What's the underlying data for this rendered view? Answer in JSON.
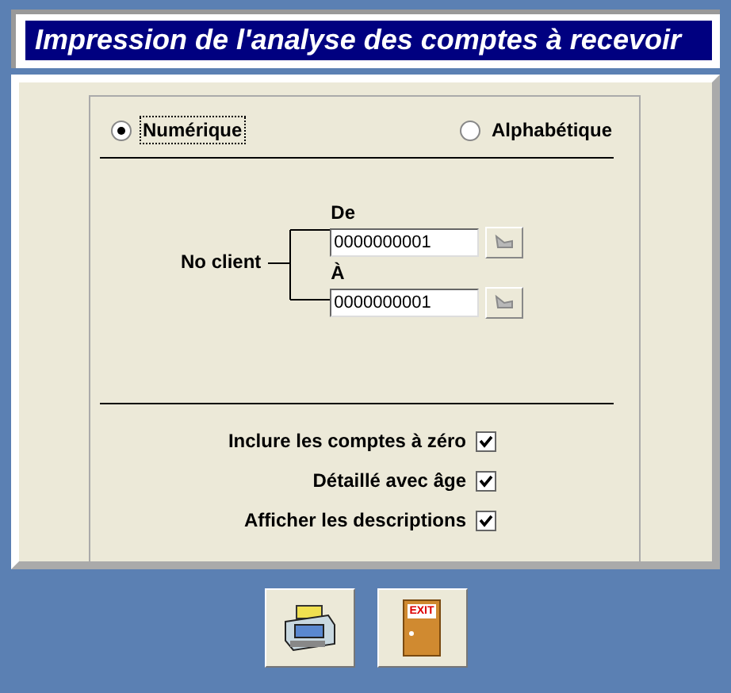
{
  "window": {
    "title": "Impression de l'analyse des comptes à recevoir"
  },
  "sort_options": [
    {
      "label": "Numérique",
      "selected": true
    },
    {
      "label": "Alphabétique",
      "selected": false
    }
  ],
  "client_range": {
    "label": "No client",
    "fields": [
      {
        "label": "De",
        "value": "0000000001"
      },
      {
        "label": "À",
        "value": "0000000001"
      }
    ]
  },
  "options": [
    {
      "label": "Inclure les comptes à zéro",
      "checked": true
    },
    {
      "label": "Détaillé avec âge",
      "checked": true
    },
    {
      "label": "Afficher les descriptions",
      "checked": true
    }
  ],
  "buttons": [
    {
      "kind": "print"
    },
    {
      "kind": "exit",
      "sign": "EXIT"
    }
  ]
}
